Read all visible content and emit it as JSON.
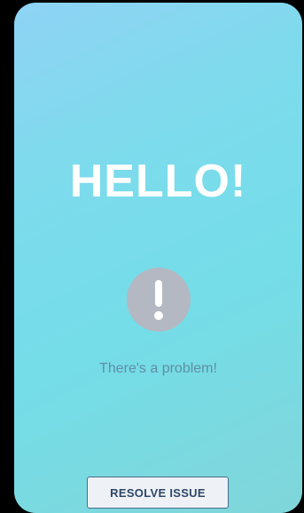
{
  "screen": {
    "headline": "HELLO!",
    "message": "There's a problem!",
    "resolve_button_label": "RESOLVE ISSUE",
    "status_icon": "exclamation-circle-icon"
  },
  "colors": {
    "background_gradient": [
      "#8fd3f4",
      "#74dde8",
      "#80d6d9"
    ],
    "headline": "#ffffff",
    "icon_circle": "#b4b8c2",
    "message_text": "#5e8fa6",
    "button_border": "#4a6a8c",
    "button_background": "#eef2f7",
    "button_text": "#2f4666"
  }
}
